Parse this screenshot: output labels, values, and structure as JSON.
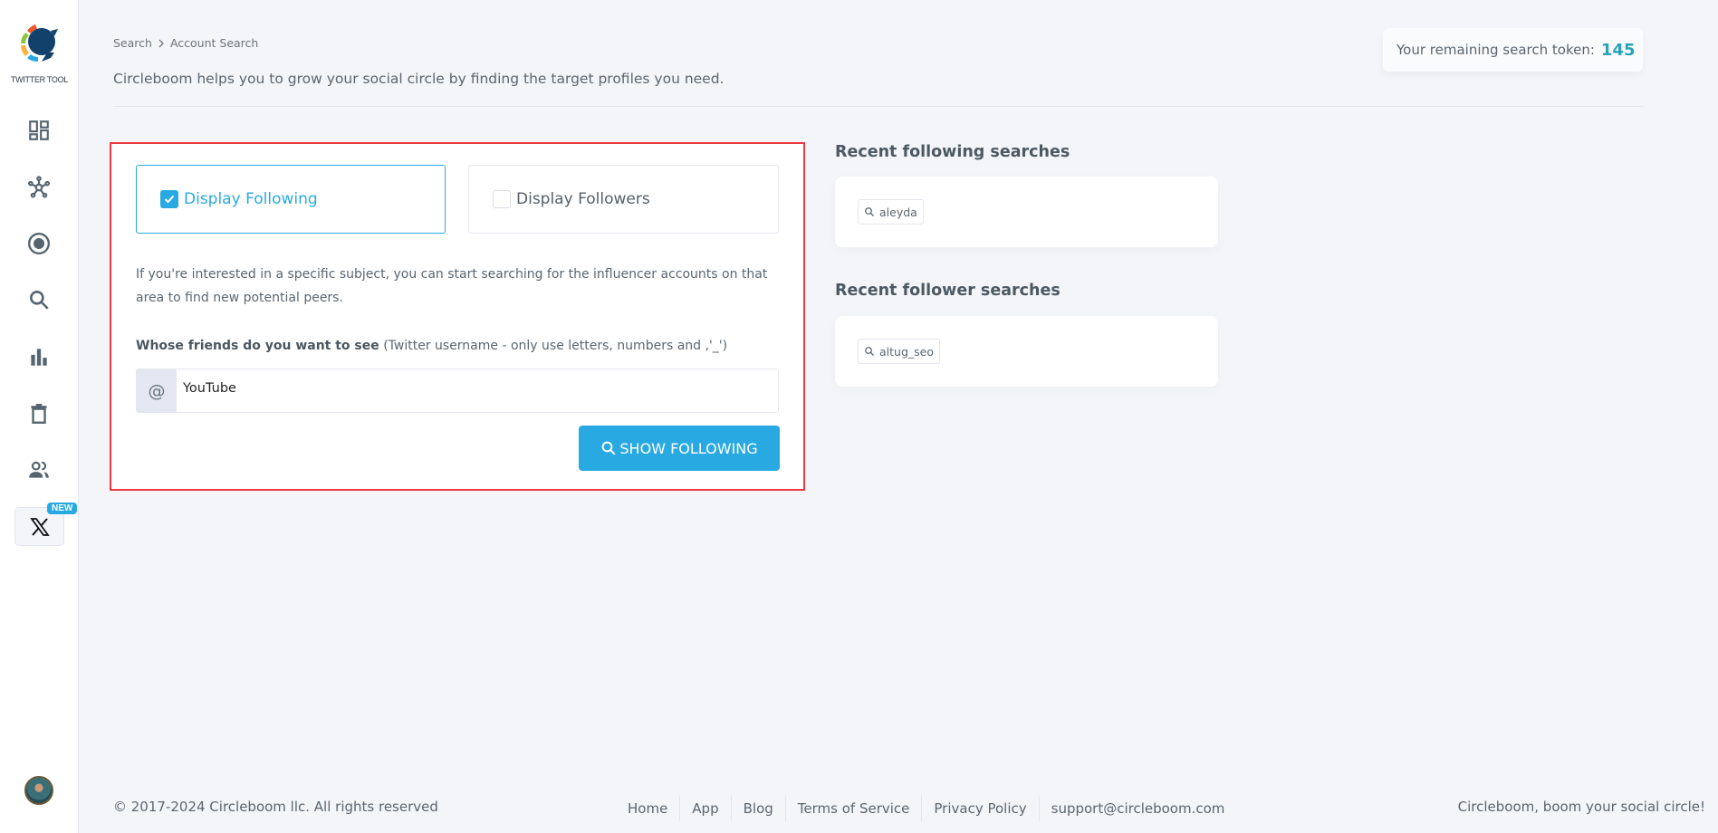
{
  "sidebar": {
    "logo_text": "TWITTER TOOL",
    "items": [
      {
        "name": "dashboard",
        "icon": "dashboard-icon"
      },
      {
        "name": "network",
        "icon": "network-icon"
      },
      {
        "name": "circle",
        "icon": "target-icon"
      },
      {
        "name": "search",
        "icon": "search-icon"
      },
      {
        "name": "analytics",
        "icon": "bar-chart-icon"
      },
      {
        "name": "delete",
        "icon": "trash-icon"
      },
      {
        "name": "users",
        "icon": "users-icon"
      },
      {
        "name": "x",
        "icon": "x-logo-icon",
        "badge": "NEW"
      }
    ]
  },
  "breadcrumb": {
    "items": [
      "Search",
      "Account Search"
    ],
    "separator": ">"
  },
  "header": {
    "subtitle": "Circleboom helps you to grow your social circle by finding the target profiles you need.",
    "token_label": "Your remaining search token:",
    "token_value": "145"
  },
  "form": {
    "option_following": "Display Following",
    "option_followers": "Display Followers",
    "following_checked": true,
    "followers_checked": false,
    "description": "If you're interested in a specific subject, you can start searching for the influencer accounts on that area to find new potential peers.",
    "label_bold": "Whose friends do you want to see",
    "label_hint": "(Twitter username - only use letters, numbers and ,'_')",
    "addon": "@",
    "username_value": "YouTube",
    "submit_label": "SHOW FOLLOWING"
  },
  "recent": {
    "following_title": "Recent following searches",
    "following_items": [
      "aleyda"
    ],
    "follower_title": "Recent follower searches",
    "follower_items": [
      "altug_seo"
    ]
  },
  "footer": {
    "copyright": "© 2017-2024 Circleboom llc. All rights reserved",
    "links": [
      "Home",
      "App",
      "Blog",
      "Terms of Service",
      "Privacy Policy",
      "support@circleboom.com"
    ],
    "tagline": "Circleboom, boom your social circle!"
  },
  "colors": {
    "accent": "#29a9e1",
    "highlight": "#ec3b40",
    "token": "#29a3b8"
  }
}
